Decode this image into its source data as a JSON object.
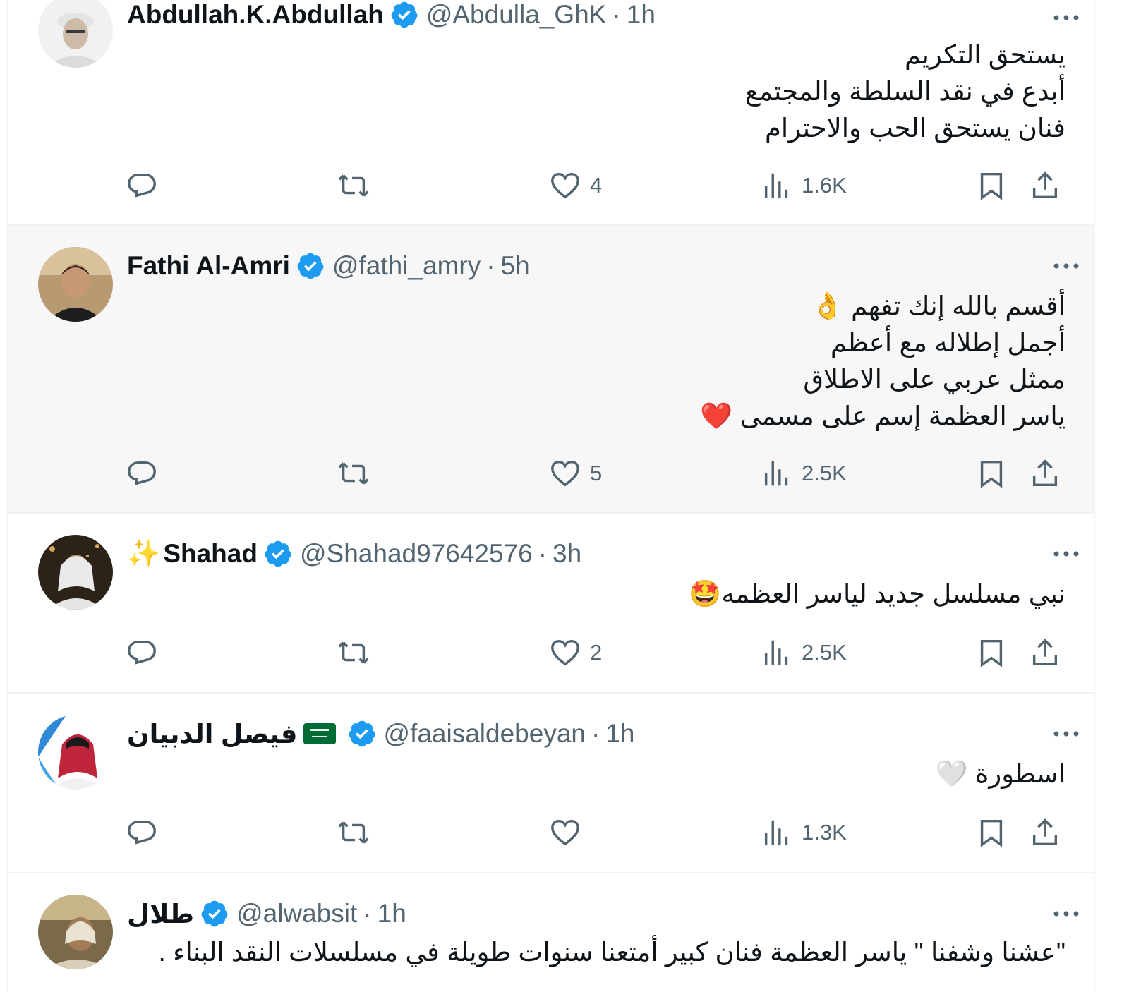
{
  "tweets": [
    {
      "name": "Abdullah.K.Abdullah",
      "handle": "@Abdulla_GhK",
      "separator": "·",
      "time": "1h",
      "lines": [
        "يستحق التكريم",
        "أبدع في نقد السلطة والمجتمع",
        "فنان يستحق الحب والاحترام"
      ],
      "likes": "4",
      "views": "1.6K"
    },
    {
      "name": "Fathi Al-Amri",
      "handle": "@fathi_amry",
      "separator": "·",
      "time": "5h",
      "lines": [
        "أقسم بالله إنك تفهم 👌",
        "أجمل إطلاله مع أعظم",
        "ممثل عربي على الاطلاق",
        "ياسر العظمة إسم على مسمى ❤️"
      ],
      "likes": "5",
      "views": "2.5K"
    },
    {
      "name_prefix": "✨",
      "name": "Shahad",
      "handle": "@Shahad97642576",
      "separator": "·",
      "time": "3h",
      "lines": [
        "نبي مسلسل جديد لياسر العظمه🤩"
      ],
      "likes": "2",
      "views": "2.5K"
    },
    {
      "name": "فيصل الدبيان",
      "handle": "@faaisaldebeyan",
      "separator": "·",
      "time": "1h",
      "lines": [
        "اسطورة 🤍"
      ],
      "likes": "",
      "views": "1.3K"
    },
    {
      "name": "طلال",
      "handle": "@alwabsit",
      "separator": "·",
      "time": "1h",
      "lines": [
        "\"عشنا وشفنا \" ياسر العظمة فنان كبير أمتعنا سنوات طويلة في مسلسلات النقد البناء ."
      ]
    }
  ],
  "icons": {
    "reply": "reply-icon",
    "retweet": "retweet-icon",
    "like": "heart-icon",
    "views": "views-icon",
    "bookmark": "bookmark-icon",
    "share": "share-icon",
    "more": "more-icon",
    "verified": "verified-badge-icon",
    "flag": "saudi-flag-icon"
  },
  "colors": {
    "verified": "#1d9bf0",
    "muted": "#536471",
    "text": "#0f1419",
    "hover_bg": "#f7f7f7",
    "divider": "#eff3f4"
  }
}
